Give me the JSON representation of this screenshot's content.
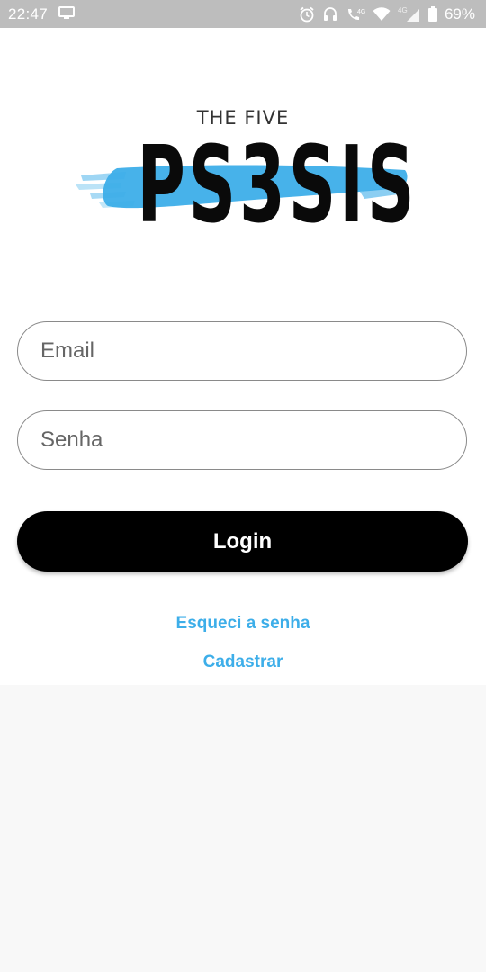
{
  "status_bar": {
    "time": "22:47",
    "battery_text": "69%",
    "network_label": "4G",
    "network_label_2": "4G"
  },
  "logo": {
    "top_text": "THE FIVE",
    "main_text": "PS3SIS",
    "brush_color": "#3daee9"
  },
  "form": {
    "email_placeholder": "Email",
    "email_value": "",
    "password_placeholder": "Senha",
    "password_value": "",
    "login_label": "Login"
  },
  "links": {
    "forgot_password": "Esqueci a senha",
    "register": "Cadastrar"
  },
  "colors": {
    "accent": "#3daee9",
    "button": "#000000",
    "status_bar": "#bdbdbd",
    "background": "#f8f8f8"
  }
}
